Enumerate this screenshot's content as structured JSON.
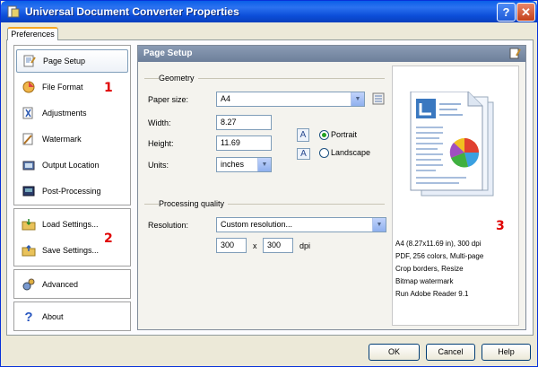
{
  "window": {
    "title": "Universal Document Converter Properties",
    "help_glyph": "?",
    "close_glyph": "✕"
  },
  "tabs": {
    "preferences": "Preferences"
  },
  "sidebar": {
    "items": [
      {
        "label": "Page Setup",
        "icon": "page-setup-icon",
        "selected": true
      },
      {
        "label": "File Format",
        "icon": "file-format-icon"
      },
      {
        "label": "Adjustments",
        "icon": "adjustments-icon"
      },
      {
        "label": "Watermark",
        "icon": "watermark-icon"
      },
      {
        "label": "Output Location",
        "icon": "output-location-icon"
      },
      {
        "label": "Post-Processing",
        "icon": "post-processing-icon"
      }
    ],
    "settings": [
      {
        "label": "Load Settings...",
        "icon": "load-settings-icon"
      },
      {
        "label": "Save Settings...",
        "icon": "save-settings-icon"
      }
    ],
    "advanced": "Advanced",
    "about": "About"
  },
  "markers": {
    "one": "1",
    "two": "2",
    "three": "3"
  },
  "panel": {
    "title": "Page Setup",
    "geometry": {
      "group": "Geometry",
      "paper_size_label": "Paper size:",
      "paper_size_value": "A4",
      "width_label": "Width:",
      "width_value": "8.27",
      "height_label": "Height:",
      "height_value": "11.69",
      "units_label": "Units:",
      "units_value": "inches",
      "portrait_label": "Portrait",
      "landscape_label": "Landscape",
      "orientation": "Portrait",
      "orientation_glyph": "A"
    },
    "quality": {
      "group": "Processing quality",
      "resolution_label": "Resolution:",
      "resolution_value": "Custom resolution...",
      "dpi_x": "300",
      "dpi_y": "300",
      "x_label": "x",
      "dpi_label": "dpi"
    },
    "preview_info": [
      "A4 (8.27x11.69 in), 300 dpi",
      "PDF, 256 colors, Multi-page",
      "Crop borders, Resize",
      "Bitmap watermark",
      "Run Adobe Reader 9.1"
    ]
  },
  "buttons": {
    "ok": "OK",
    "cancel": "Cancel",
    "help": "Help"
  },
  "colors": {
    "title_bar": "#0a5fe8",
    "panel_header": "#7a8ca7",
    "marker": "#e00000"
  }
}
